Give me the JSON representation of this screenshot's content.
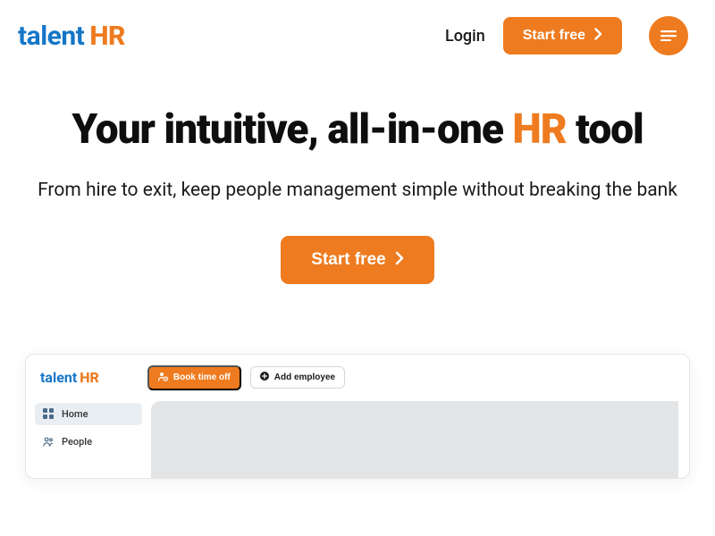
{
  "header": {
    "logo_talent": "talent",
    "logo_hr": "HR",
    "login": "Login",
    "start_free": "Start free"
  },
  "hero": {
    "title_pre": "Your intuitive, all-in-one ",
    "title_accent": "HR",
    "title_post": " tool",
    "subtitle": "From hire to exit, keep people management simple without breaking the bank",
    "cta": "Start free"
  },
  "preview": {
    "logo_talent": "talent",
    "logo_hr": "HR",
    "book_time_off": "Book time off",
    "add_employee": "Add employee",
    "sidebar": [
      {
        "label": "Home"
      },
      {
        "label": "People"
      }
    ]
  },
  "colors": {
    "accent": "#ee7b1f",
    "brand_blue": "#1576c7"
  }
}
